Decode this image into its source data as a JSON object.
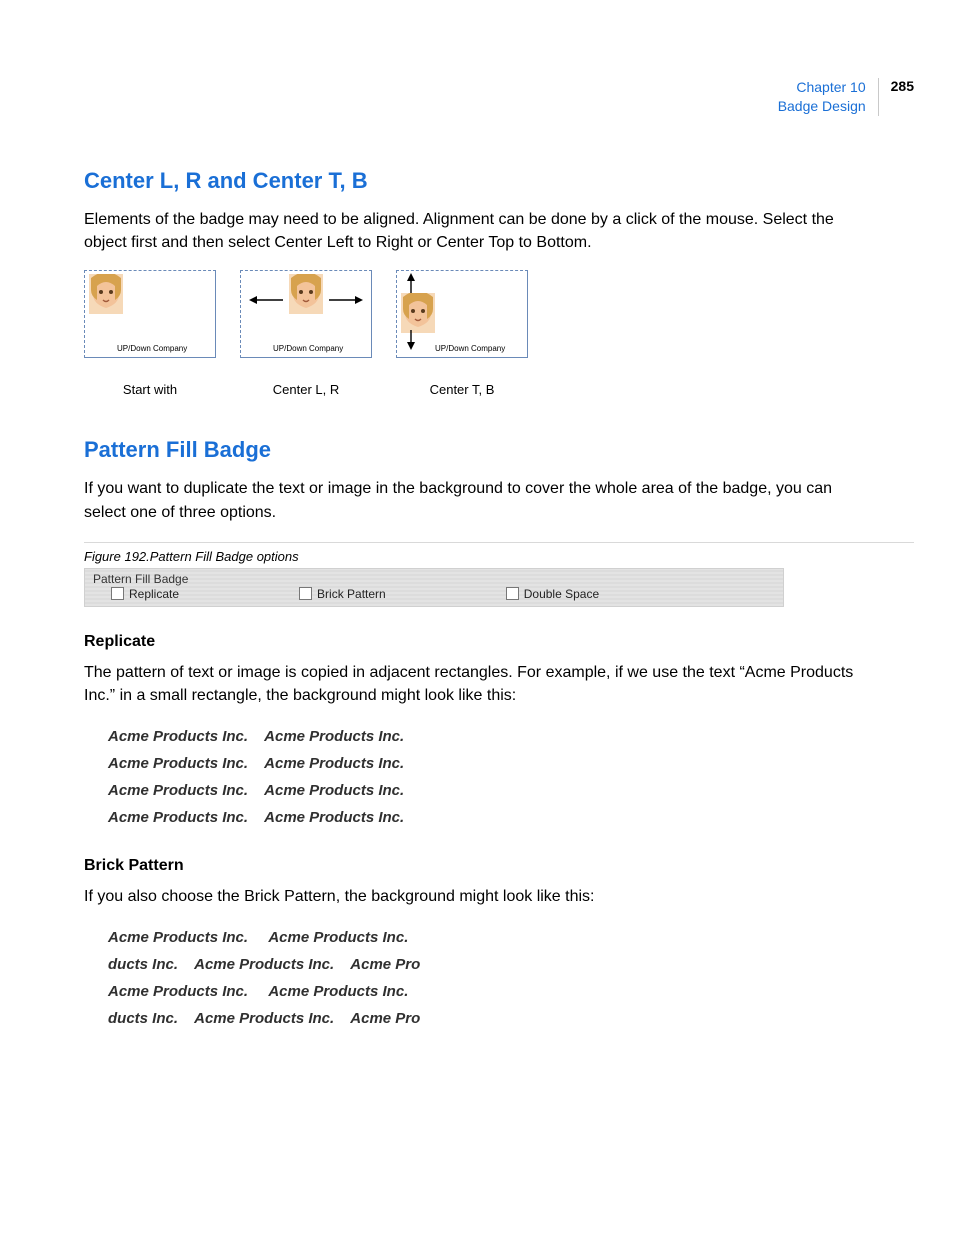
{
  "header": {
    "chapter": "Chapter 10",
    "section": "Badge Design",
    "page_number": "285"
  },
  "sec1": {
    "title": "Center L, R and Center T, B",
    "para": "Elements of the badge may need to be aligned. Alignment can be done by a click of the mouse. Select the object first and then select Center Left to Right or Center Top to Bottom.",
    "badges": {
      "company_text": "UP/Down Company",
      "cap1": "Start with",
      "cap2": "Center L, R",
      "cap3": "Center T, B"
    }
  },
  "sec2": {
    "title": "Pattern Fill Badge",
    "para": "If you want to duplicate the text or image in the background to cover the whole area of the badge, you can select one of three options.",
    "fig_caption": "Figure 192.Pattern Fill Badge options",
    "ui": {
      "group_title": "Pattern Fill Badge",
      "opt1": "Replicate",
      "opt2": "Brick Pattern",
      "opt3": "Double Space"
    }
  },
  "replicate": {
    "title": "Replicate",
    "para": "The pattern of text or image is copied in adjacent rectangles. For example, if we use the text “Acme Products Inc.” in a small rectangle, the background might look like this:",
    "rows": [
      "Acme Products Inc.    Acme Products Inc.",
      "Acme Products Inc.    Acme Products Inc.",
      "Acme Products Inc.    Acme Products Inc.",
      "Acme Products Inc.    Acme Products Inc."
    ]
  },
  "brick": {
    "title": "Brick Pattern",
    "para": "If you also choose the Brick Pattern, the background might look like this:",
    "rows": [
      "Acme Products Inc.     Acme Products Inc.",
      "ducts Inc.    Acme Products Inc.    Acme Pro",
      "Acme Products Inc.     Acme Products Inc.",
      "ducts Inc.    Acme Products Inc.    Acme Pro"
    ]
  }
}
